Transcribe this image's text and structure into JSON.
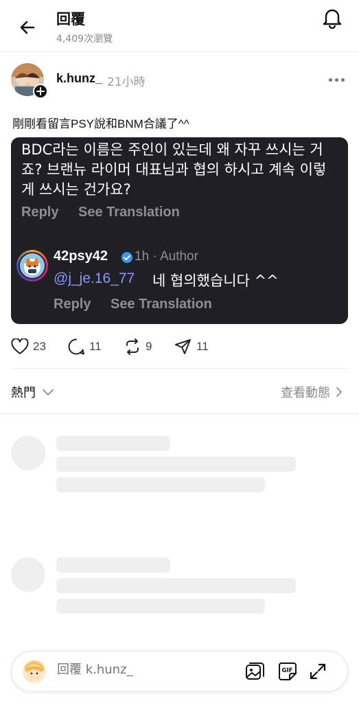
{
  "header": {
    "title": "回覆",
    "views": "4,409次瀏覽"
  },
  "post": {
    "username": "k.hunz_",
    "time": "21小時",
    "text": "剛剛看留言PSY說和BNM合議了^^",
    "embedded_comment": {
      "text": "BDC라는 이름은 주인이 있는데 왜 자꾸 쓰시는 거죠? 브랜뉴 라이머 대표님과 협의 하시고 계속 이렇게 쓰시는 건가요?",
      "reply_label": "Reply",
      "translate_label": "See Translation",
      "reply": {
        "username": "42psy42",
        "meta": "1h · Author",
        "mention": "@j_je.16_77",
        "text": "네 협의했습니다 ^^",
        "reply_label": "Reply",
        "translate_label": "See Translation"
      }
    },
    "stats": {
      "likes": "23",
      "comments": "11",
      "reposts": "9",
      "shares": "11"
    }
  },
  "sort": {
    "label": "熱門",
    "activity_label": "查看動態"
  },
  "composer": {
    "placeholder": "回覆 k.hunz_"
  },
  "icons": [
    "back-arrow-icon",
    "bell-icon",
    "more-icon",
    "heart-icon",
    "comment-icon",
    "repost-icon",
    "share-icon",
    "chevron-down-icon",
    "chevron-right-icon",
    "image-icon",
    "gif-icon",
    "expand-icon",
    "verified-icon",
    "plus-icon"
  ]
}
